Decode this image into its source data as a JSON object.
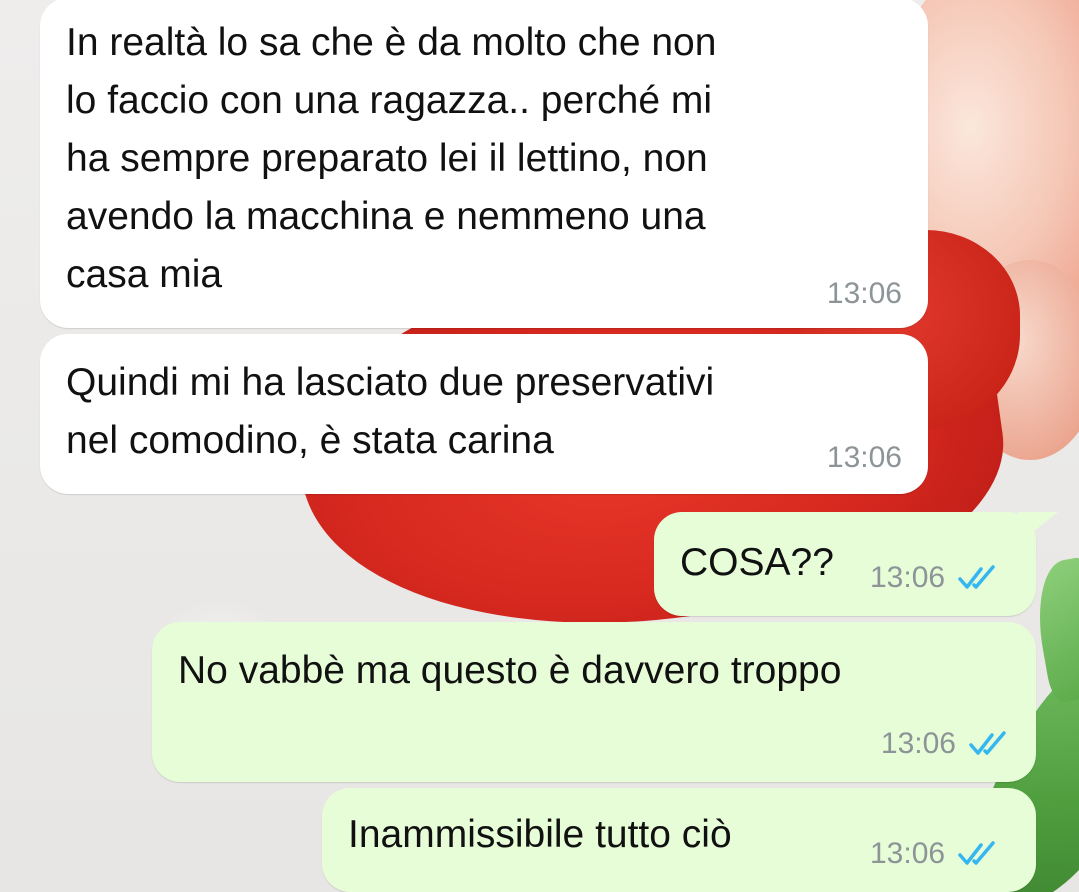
{
  "chat": {
    "messages": [
      {
        "direction": "incoming",
        "text": "In realtà lo sa che è da molto che non\nlo faccio con una ragazza.. perché mi\nha sempre preparato lei il lettino, non\navendo la macchina e nemmeno una\ncasa mia",
        "time": "13:06"
      },
      {
        "direction": "incoming",
        "text": "Quindi mi ha lasciato due preservativi\nnel comodino, è stata carina",
        "time": "13:06"
      },
      {
        "direction": "outgoing",
        "text": "COSA??",
        "time": "13:06",
        "status_icon": "double-check-icon"
      },
      {
        "direction": "outgoing",
        "text": "No vabbè ma questo è davvero troppo",
        "time": "13:06",
        "status_icon": "double-check-icon"
      },
      {
        "direction": "outgoing",
        "text": "Inammissibile tutto ciò",
        "time": "13:06",
        "status_icon": "double-check-icon"
      }
    ]
  },
  "colors": {
    "incoming_bubble": "#ffffff",
    "outgoing_bubble": "#e7fdd8",
    "timestamp": "#8c9497",
    "read_ticks": "#34b7f1"
  }
}
